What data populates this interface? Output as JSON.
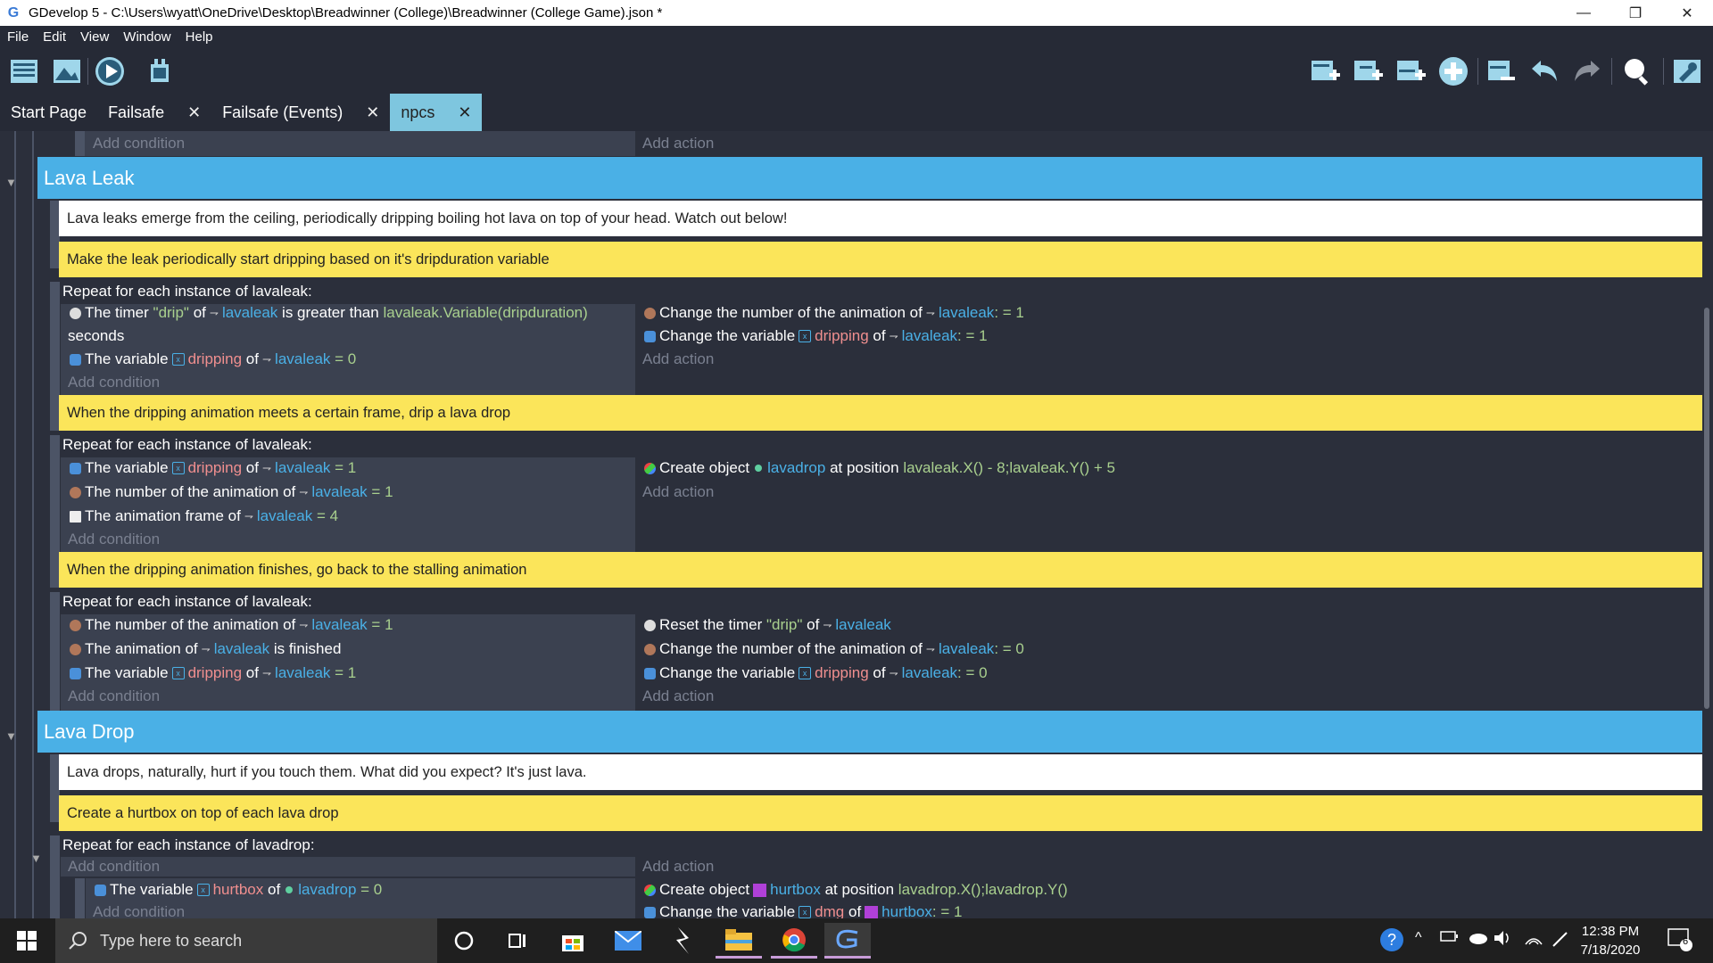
{
  "window": {
    "title": "GDevelop 5 - C:\\Users\\wyatt\\OneDrive\\Desktop\\Breadwinner (College)\\Breadwinner (College Game).json *",
    "minimize": "—",
    "maximize": "❐",
    "close": "✕"
  },
  "menu": [
    "File",
    "Edit",
    "View",
    "Window",
    "Help"
  ],
  "toolbar": {
    "left": [
      "project-manager-icon",
      "scene-icon",
      "preview-icon",
      "debug-icon"
    ],
    "right": [
      "add-event-icon",
      "add-subevent-icon",
      "add-other-event-icon",
      "add-icon",
      "delete-icon",
      "undo-icon",
      "redo-icon",
      "search-icon",
      "settings-icon"
    ]
  },
  "tabs": [
    {
      "label": "Start Page",
      "closable": false
    },
    {
      "label": "Failsafe",
      "closable": true
    },
    {
      "label": "Failsafe (Events)",
      "closable": true
    },
    {
      "label": "npcs",
      "closable": true,
      "active": true
    }
  ],
  "close_glyph": "✕",
  "events": {
    "top_add_condition": "Add condition",
    "top_add_action": "Add action",
    "group1": {
      "title": "Lava Leak",
      "comment": "Lava leaks emerge from the ceiling, periodically dripping boiling hot lava on top of your head. Watch out below!",
      "block1": {
        "comment": "Make the leak periodically start dripping based on it's dripduration variable",
        "repeat": "Repeat for each instance of lavaleak:",
        "c1": {
          "a": "The timer",
          "b": "\"drip\"",
          "c": "of",
          "d": "lavaleak",
          "e": "is greater than",
          "f": "lavaleak.Variable(dripduration)",
          "g": "seconds"
        },
        "c2": {
          "a": "The variable",
          "b": "dripping",
          "c": "of",
          "d": "lavaleak",
          "e": "= 0"
        },
        "add_condition": "Add condition",
        "a1": {
          "a": "Change the number of the animation of",
          "b": "lavaleak",
          "c": ": = 1"
        },
        "a2": {
          "a": "Change the variable",
          "b": "dripping",
          "c": "of",
          "d": "lavaleak",
          "e": ": = 1"
        },
        "add_action": "Add action"
      },
      "block2": {
        "comment": "When the dripping animation meets a certain frame, drip a lava drop",
        "repeat": "Repeat for each instance of lavaleak:",
        "c1": {
          "a": "The variable",
          "b": "dripping",
          "c": "of",
          "d": "lavaleak",
          "e": "= 1"
        },
        "c2": {
          "a": "The number of the animation of",
          "b": "lavaleak",
          "c": "= 1"
        },
        "c3": {
          "a": "The animation frame of",
          "b": "lavaleak",
          "c": "= 4"
        },
        "add_condition": "Add condition",
        "a1": {
          "a": "Create object",
          "b": "lavadrop",
          "c": "at position",
          "d": "lavaleak.X() - 8;lavaleak.Y() + 5"
        },
        "add_action": "Add action"
      },
      "block3": {
        "comment": "When the dripping animation finishes, go back to the stalling animation",
        "repeat": "Repeat for each instance of lavaleak:",
        "c1": {
          "a": "The number of the animation of",
          "b": "lavaleak",
          "c": "= 1"
        },
        "c2": {
          "a": "The animation of",
          "b": "lavaleak",
          "c": "is finished"
        },
        "c3": {
          "a": "The variable",
          "b": "dripping",
          "c": "of",
          "d": "lavaleak",
          "e": "= 1"
        },
        "add_condition": "Add condition",
        "a1": {
          "a": "Reset the timer",
          "b": "\"drip\"",
          "c": "of",
          "d": "lavaleak"
        },
        "a2": {
          "a": "Change the number of the animation of",
          "b": "lavaleak",
          "c": ": = 0"
        },
        "a3": {
          "a": "Change the variable",
          "b": "dripping",
          "c": "of",
          "d": "lavaleak",
          "e": ": = 0"
        },
        "add_action": "Add action"
      }
    },
    "group2": {
      "title": "Lava Drop",
      "comment": "Lava drops, naturally, hurt if you touch them. What did you expect? It's just lava.",
      "block1": {
        "comment": "Create a hurtbox on top of each lava drop",
        "repeat": "Repeat for each instance of lavadrop:",
        "add_condition": "Add condition",
        "add_action": "Add action",
        "sub_c1": {
          "a": "The variable",
          "b": "hurtbox",
          "c": "of",
          "d": "lavadrop",
          "e": "= 0"
        },
        "sub_add_condition": "Add condition",
        "sub_a1": {
          "a": "Create object",
          "b": "hurtbox",
          "c": "at position",
          "d": "lavadrop.X();lavadrop.Y()"
        },
        "sub_a2": {
          "a": "Change the variable",
          "b": "dmg",
          "c": "of",
          "d": "hurtbox",
          "e": ": = 1"
        }
      }
    }
  },
  "taskbar": {
    "search_placeholder": "Type here to search",
    "time": "12:38 PM",
    "date": "7/18/2020",
    "notifications": "6",
    "apps": [
      "cortana-icon",
      "task-view-icon",
      "store-icon",
      "mail-icon",
      "app-icon",
      "file-explorer-icon",
      "chrome-icon",
      "gdevelop-icon"
    ]
  }
}
